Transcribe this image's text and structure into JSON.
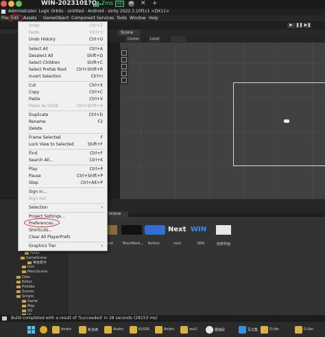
{
  "remote_bar": {
    "title": "WIN-2023101?O...",
    "close": "×",
    "latency": "7ms",
    "hd": "HD",
    "avatar": "RP",
    "x": "✕",
    "plus": "+"
  },
  "window": {
    "title": "Administrator: Logic Orbits - Untitled - Android - Unity 2022.3.10f1c1 <DX11>"
  },
  "menubar": {
    "items": [
      "File",
      "Edit",
      "Assets",
      "GameObject",
      "Component",
      "Services",
      "Tools",
      "Window",
      "Help"
    ]
  },
  "toolbar": {
    "play": "▶",
    "pause": "❚❚",
    "step": "▶❚"
  },
  "scene": {
    "tab_label": "Scene",
    "center_label": "Center",
    "local_label": "Local"
  },
  "edit_menu": {
    "items": [
      {
        "label": "Undo",
        "shortcut": "Ctrl+Z",
        "disabled": true
      },
      {
        "label": "Redo",
        "shortcut": "Ctrl+Y",
        "disabled": true
      },
      {
        "label": "Undo History",
        "shortcut": "Ctrl+U",
        "disabled": false
      },
      {
        "label": "Select All",
        "shortcut": "Ctrl+A",
        "disabled": false
      },
      {
        "label": "Deselect All",
        "shortcut": "Shift+D",
        "disabled": false
      },
      {
        "label": "Select Children",
        "shortcut": "Shift+C",
        "disabled": false
      },
      {
        "label": "Select Prefab Root",
        "shortcut": "Ctrl+Shift+R",
        "disabled": false
      },
      {
        "label": "Invert Selection",
        "shortcut": "Ctrl+I",
        "disabled": false
      },
      {
        "label": "Cut",
        "shortcut": "Ctrl+X",
        "disabled": false
      },
      {
        "label": "Copy",
        "shortcut": "Ctrl+C",
        "disabled": false
      },
      {
        "label": "Paste",
        "shortcut": "Ctrl+V",
        "disabled": false
      },
      {
        "label": "Paste As Child",
        "shortcut": "Ctrl+Shift+V",
        "disabled": true
      },
      {
        "label": "Duplicate",
        "shortcut": "Ctrl+D",
        "disabled": false
      },
      {
        "label": "Rename",
        "shortcut": "F2",
        "disabled": false
      },
      {
        "label": "Delete",
        "shortcut": "",
        "disabled": false
      },
      {
        "label": "Frame Selected",
        "shortcut": "F",
        "disabled": false
      },
      {
        "label": "Lock View to Selected",
        "shortcut": "Shift+F",
        "disabled": false
      },
      {
        "label": "Find",
        "shortcut": "Ctrl+F",
        "disabled": false
      },
      {
        "label": "Search All...",
        "shortcut": "Ctrl+K",
        "disabled": false
      },
      {
        "label": "Play",
        "shortcut": "Ctrl+P",
        "disabled": false
      },
      {
        "label": "Pause",
        "shortcut": "Ctrl+Shift+P",
        "disabled": false
      },
      {
        "label": "Step",
        "shortcut": "Ctrl+Alt+P",
        "disabled": false
      },
      {
        "label": "Sign in...",
        "shortcut": "",
        "disabled": false
      },
      {
        "label": "Sign out",
        "shortcut": "",
        "disabled": true
      },
      {
        "label": "Selection",
        "shortcut": "",
        "disabled": false,
        "submenu": true
      },
      {
        "label": "Project Settings...",
        "shortcut": "",
        "disabled": false
      },
      {
        "label": "Preferences...",
        "shortcut": "",
        "disabled": false
      },
      {
        "label": "Shortcuts...",
        "shortcut": "",
        "disabled": false
      },
      {
        "label": "Clear All PlayerPrefs",
        "shortcut": "",
        "disabled": false
      },
      {
        "label": "Graphics Tier",
        "shortcut": "",
        "disabled": false,
        "submenu": true
      }
    ]
  },
  "bottom": {
    "tab_label": "Scene",
    "assets": [
      "ground",
      "BlackBack...",
      "Button",
      "next",
      "WIN",
      "结算界面"
    ],
    "next_text": "Next",
    "win_text": "WIN"
  },
  "hierarchy": {
    "items": [
      "Fonts",
      "GameScene",
      "等级数字",
      "Icon",
      "MenuScene",
      "Data",
      "Editor",
      "Prefabs",
      "Scenes",
      "Scripts",
      "Game",
      "Map",
      "SO",
      "UI"
    ]
  },
  "status": {
    "text": "Build completed with a result of 'Succeeded' in 28 seconds (28153 ms)"
  },
  "taskbar": {
    "items": [
      "Andro",
      "新加坡",
      "Andro",
      "61026",
      "Andro",
      "out2",
      "键抽屉",
      "写文集",
      "D:\\An",
      "D:\\An"
    ]
  }
}
